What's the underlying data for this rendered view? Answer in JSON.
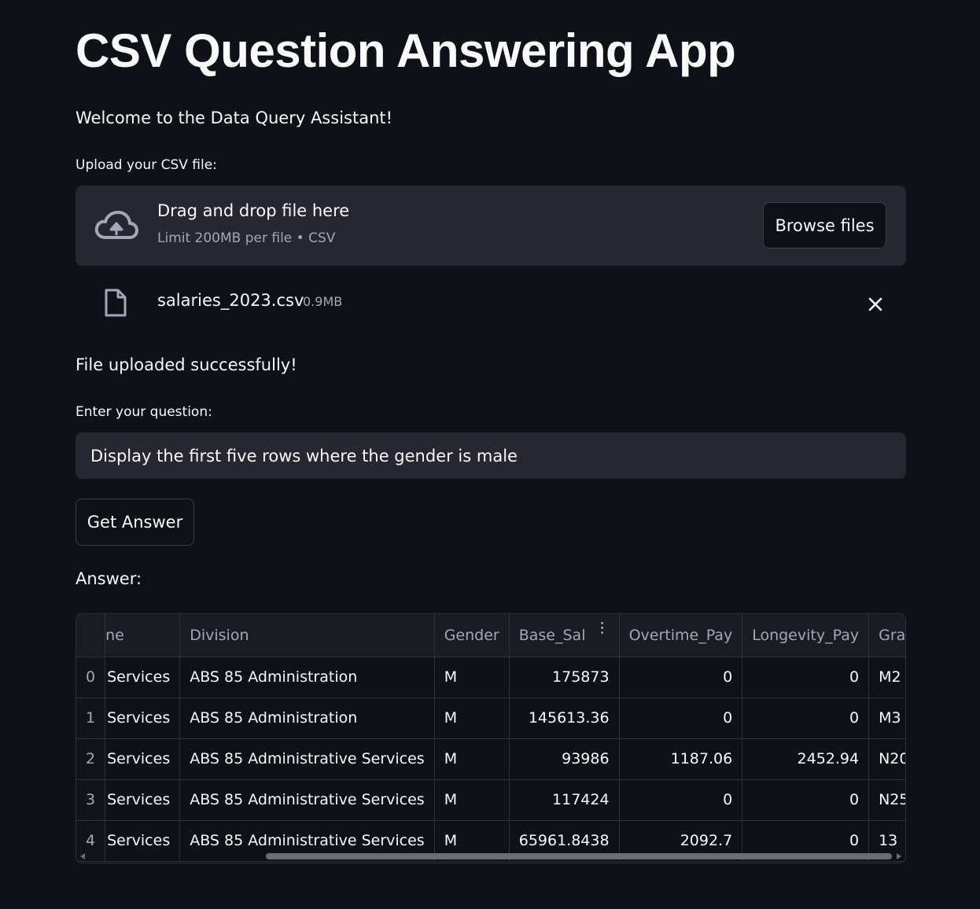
{
  "app": {
    "title": "CSV Question Answering App",
    "welcome": "Welcome to the Data Query Assistant!"
  },
  "uploader": {
    "label": "Upload your CSV file:",
    "drop_text": "Drag and drop file here",
    "limit_text": "Limit 200MB per file • CSV",
    "browse_label": "Browse files",
    "file_name": "salaries_2023.csv",
    "file_size": "0.9MB"
  },
  "status": {
    "success": "File uploaded successfully!"
  },
  "question": {
    "label": "Enter your question:",
    "value": "Display the first five rows where the gender is male"
  },
  "actions": {
    "get_answer_label": "Get Answer"
  },
  "answer": {
    "label": "Answer:",
    "columns": [
      "ne",
      "Division",
      "Gender",
      "Base_Sal",
      "Overtime_Pay",
      "Longevity_Pay",
      "Grade"
    ],
    "rows": [
      {
        "index": "0",
        "c0": "Services",
        "division": "ABS 85 Administration",
        "gender": "M",
        "base": "175873",
        "overtime": "0",
        "longevity": "0",
        "grade": "M2"
      },
      {
        "index": "1",
        "c0": "Services",
        "division": "ABS 85 Administration",
        "gender": "M",
        "base": "145613.36",
        "overtime": "0",
        "longevity": "0",
        "grade": "M3"
      },
      {
        "index": "2",
        "c0": "Services",
        "division": "ABS 85 Administrative Services",
        "gender": "M",
        "base": "93986",
        "overtime": "1187.06",
        "longevity": "2452.94",
        "grade": "N20"
      },
      {
        "index": "3",
        "c0": "Services",
        "division": "ABS 85 Administrative Services",
        "gender": "M",
        "base": "117424",
        "overtime": "0",
        "longevity": "0",
        "grade": "N25"
      },
      {
        "index": "4",
        "c0": "Services",
        "division": "ABS 85 Administrative Services",
        "gender": "M",
        "base": "65961.8438",
        "overtime": "2092.7",
        "longevity": "0",
        "grade": "13"
      }
    ]
  },
  "icons": {
    "upload": "cloud-upload-icon",
    "file": "file-icon",
    "remove": "close-icon",
    "column_menu": "kebab-menu-icon"
  },
  "colors": {
    "background": "#0e1117",
    "surface": "#262730",
    "text": "#fafafa",
    "muted": "#a3a8b8"
  }
}
